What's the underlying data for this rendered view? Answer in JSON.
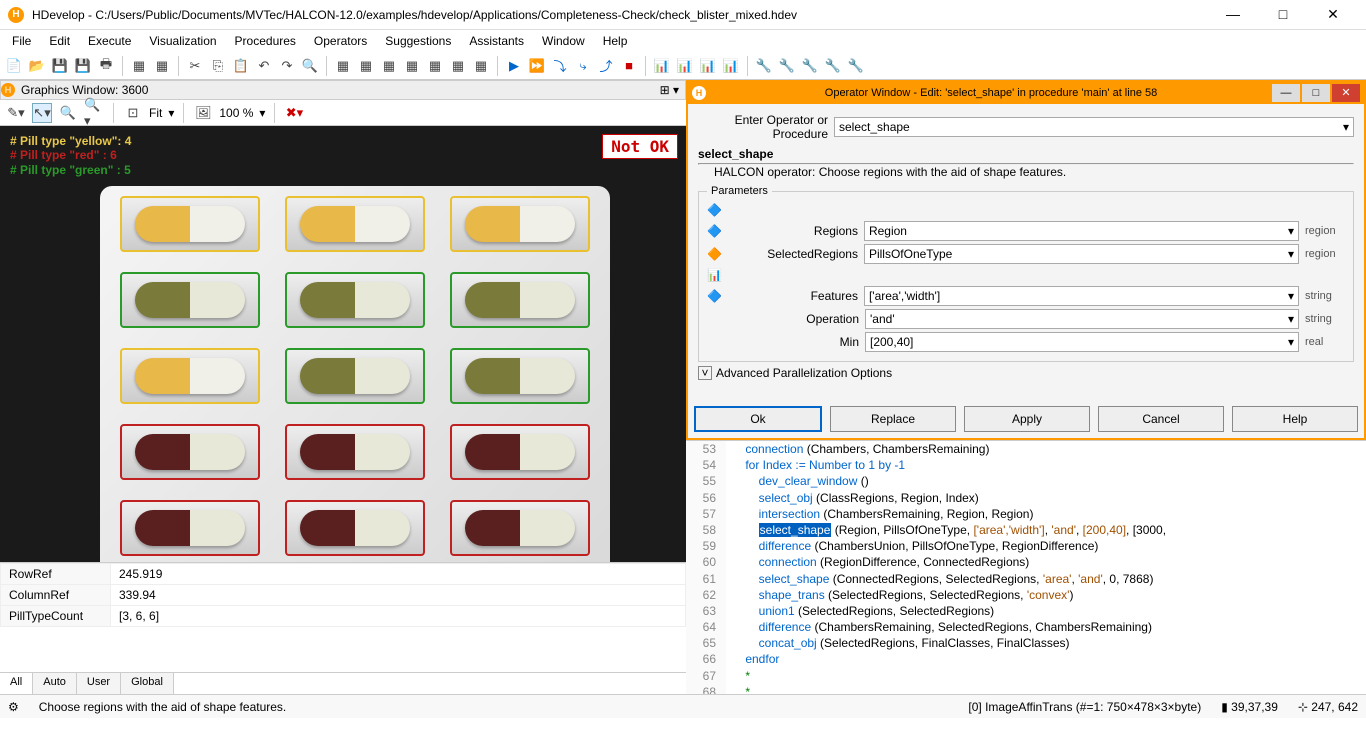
{
  "window": {
    "title": "HDevelop - C:/Users/Public/Documents/MVTec/HALCON-12.0/examples/hdevelop/Applications/Completeness-Check/check_blister_mixed.hdev"
  },
  "menus": [
    "File",
    "Edit",
    "Execute",
    "Visualization",
    "Procedures",
    "Operators",
    "Suggestions",
    "Assistants",
    "Window",
    "Help"
  ],
  "graphics": {
    "title": "Graphics Window: 3600",
    "fit": "Fit",
    "zoom": "100 %",
    "notok": "Not OK",
    "counts": {
      "yellow": "# Pill type \"yellow\": 4",
      "red": "# Pill type \"red\"   : 6",
      "green": "# Pill type \"green\" : 5"
    }
  },
  "vars": [
    [
      "RowRef",
      "245.919"
    ],
    [
      "ColumnRef",
      "339.94"
    ],
    [
      "PillTypeCount",
      "[3, 6, 6]"
    ]
  ],
  "vartabs": [
    "All",
    "Auto",
    "User",
    "Global"
  ],
  "op": {
    "title": "Operator Window - Edit: 'select_shape' in procedure 'main' at line 58",
    "enterLabel": "Enter Operator or Procedure",
    "enter": "select_shape",
    "name": "select_shape",
    "desc": "HALCON operator:  Choose regions with the aid of shape features.",
    "paramsLabel": "Parameters",
    "params": [
      {
        "label": "Regions",
        "value": "Region",
        "type": "region"
      },
      {
        "label": "SelectedRegions",
        "value": "PillsOfOneType",
        "type": "region"
      },
      {
        "label": "Features",
        "value": "['area','width']",
        "type": "string"
      },
      {
        "label": "Operation",
        "value": "'and'",
        "type": "string"
      },
      {
        "label": "Min",
        "value": "[200,40]",
        "type": "real"
      }
    ],
    "adv": "Advanced Parallelization Options",
    "btns": {
      "ok": "Ok",
      "replace": "Replace",
      "apply": "Apply",
      "cancel": "Cancel",
      "help": "Help"
    }
  },
  "code": [
    {
      "n": 53,
      "raw": "    connection (Chambers, ChambersRemaining)"
    },
    {
      "n": 54,
      "raw": "    for Index := Number to 1 by -1",
      "kw": true
    },
    {
      "n": 55,
      "raw": "        dev_clear_window ()"
    },
    {
      "n": 56,
      "raw": "        select_obj (ClassRegions, Region, Index)"
    },
    {
      "n": 57,
      "raw": "        intersection (ChambersRemaining, Region, Region)"
    },
    {
      "n": 58,
      "raw": "        select_shape (Region, PillsOfOneType, ['area','width'], 'and', [200,40], [3000,",
      "hl": "select_shape"
    },
    {
      "n": 59,
      "raw": "        difference (ChambersUnion, PillsOfOneType, RegionDifference)"
    },
    {
      "n": 60,
      "raw": "        connection (RegionDifference, ConnectedRegions)"
    },
    {
      "n": 61,
      "raw": "        select_shape (ConnectedRegions, SelectedRegions, 'area', 'and', 0, 7868)"
    },
    {
      "n": 62,
      "raw": "        shape_trans (SelectedRegions, SelectedRegions, 'convex')"
    },
    {
      "n": 63,
      "raw": "        union1 (SelectedRegions, SelectedRegions)"
    },
    {
      "n": 64,
      "raw": "        difference (ChambersRemaining, SelectedRegions, ChambersRemaining)"
    },
    {
      "n": 65,
      "raw": "        concat_obj (SelectedRegions, FinalClasses, FinalClasses)"
    },
    {
      "n": 66,
      "raw": "    endfor",
      "kw": true
    },
    {
      "n": 67,
      "raw": "    *",
      "cm": true
    },
    {
      "n": 68,
      "raw": "    *",
      "cm": true
    }
  ],
  "status": {
    "hint": "Choose regions with the aid of shape features.",
    "img": "[0] ImageAffinTrans (#=1: 750×478×3×byte)",
    "rgb": "39,37,39",
    "xy": "247, 642"
  }
}
